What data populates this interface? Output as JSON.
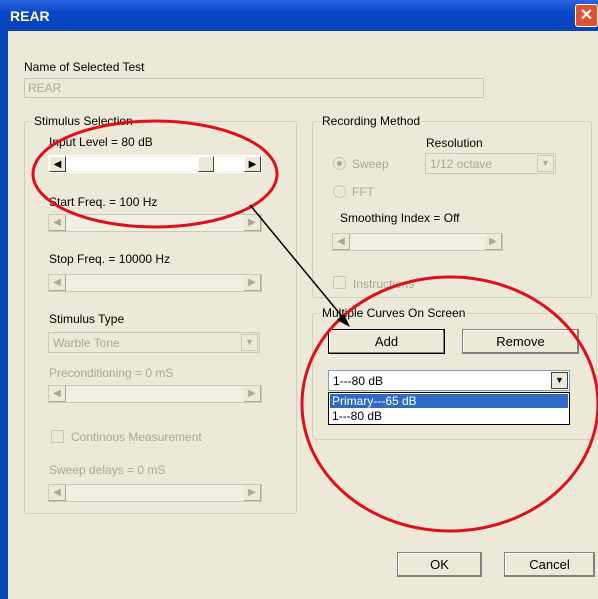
{
  "window": {
    "title": "REAR",
    "close_glyph": "✕"
  },
  "test": {
    "label": "Name of Selected Test",
    "value": "REAR"
  },
  "stimulus": {
    "group_label": "Stimulus Selection",
    "input_level_label": "Input Level  = 80 dB",
    "start_freq_label": "Start Freq. = 100 Hz",
    "stop_freq_label": "Stop Freq. = 10000 Hz",
    "stimulus_type_label": "Stimulus Type",
    "stimulus_type_value": "Warble Tone",
    "preconditioning_label": "Preconditioning = 0 mS",
    "continuous_label": "Continous Measurement",
    "sweep_delays_label": "Sweep delays = 0 mS"
  },
  "recording": {
    "group_label": "Recording Method",
    "resolution_label": "Resolution",
    "sweep_label": "Sweep",
    "resolution_value": "1/12 octave",
    "fft_label": "FFT",
    "smoothing_label": "Smoothing Index = Off",
    "instructions_label": "Instructions"
  },
  "curves": {
    "group_label": "Multiple Curves On Screen",
    "add_label": "Add",
    "remove_label": "Remove",
    "selected_value": "1---80  dB",
    "options": [
      "Primary---65  dB",
      "1---80  dB"
    ]
  },
  "footer": {
    "ok_label": "OK",
    "cancel_label": "Cancel"
  },
  "glyphs": {
    "left_arrow": "◀",
    "right_arrow": "▶",
    "down_arrow": "▼"
  },
  "colors": {
    "titlebar": "#0843b8",
    "annotation": "#e0101a",
    "selection": "#316ac5"
  }
}
